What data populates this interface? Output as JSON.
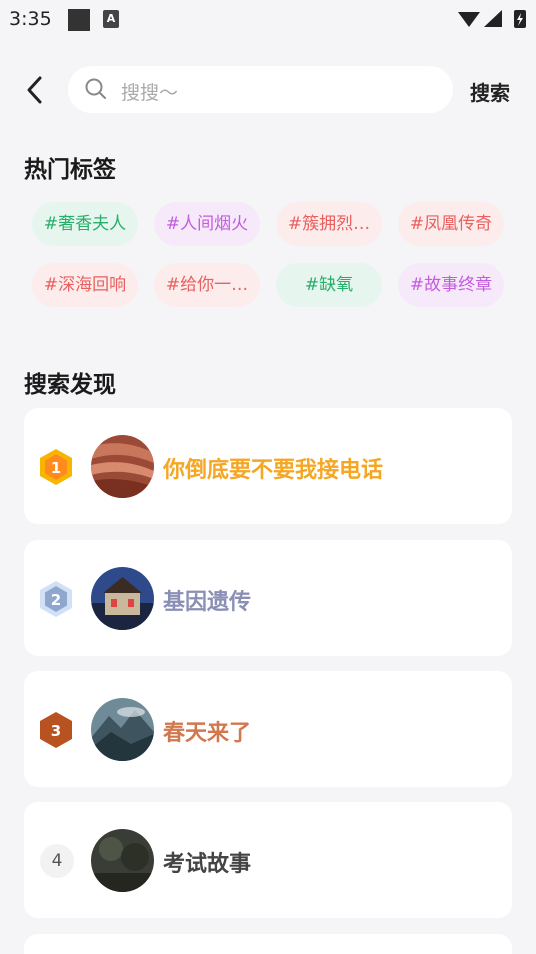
{
  "status_bar": {
    "time": "3:35",
    "a_label": "A"
  },
  "header": {
    "search_placeholder": "搜搜～",
    "search_button": "搜索"
  },
  "hot_tags": {
    "title": "热门标签",
    "items": [
      {
        "label": "#奢香夫人",
        "color": "#27ae6a",
        "bg": "#e6f5ee"
      },
      {
        "label": "#人间烟火",
        "color": "#c45be0",
        "bg": "#f6eafa"
      },
      {
        "label": "#簇拥烈…",
        "color": "#e9605f",
        "bg": "#fcecec"
      },
      {
        "label": "#凤凰传奇",
        "color": "#e9605f",
        "bg": "#fcecec"
      },
      {
        "label": "#深海回响",
        "color": "#e9605f",
        "bg": "#fcecec"
      },
      {
        "label": "#给你一…",
        "color": "#e9605f",
        "bg": "#fcecec"
      },
      {
        "label": "#缺氧",
        "color": "#27ae6a",
        "bg": "#e6f5ee"
      },
      {
        "label": "#故事终章",
        "color": "#c45be0",
        "bg": "#f6eafa"
      }
    ]
  },
  "discovery": {
    "title": "搜索发现",
    "items": [
      {
        "rank": "1",
        "title": "你倒底要不要我接电话",
        "color": "#f5a623"
      },
      {
        "rank": "2",
        "title": "基因遗传",
        "color": "#8b8fb5"
      },
      {
        "rank": "3",
        "title": "春天来了",
        "color": "#d2784f"
      },
      {
        "rank": "4",
        "title": "考试故事",
        "color": "#444444"
      }
    ]
  }
}
